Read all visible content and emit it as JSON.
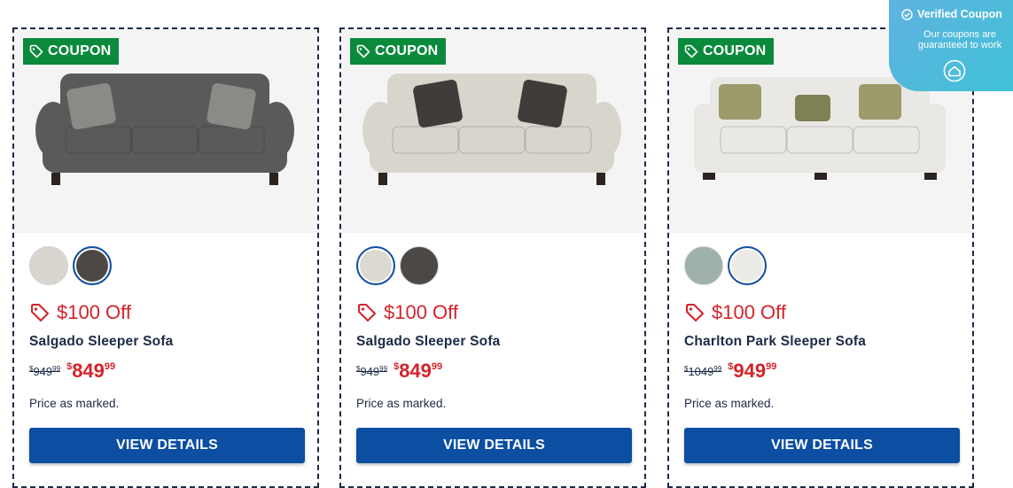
{
  "products": [
    {
      "badge": "COUPON",
      "discount": "$100 Off",
      "name": "Salgado Sleeper Sofa",
      "was_price": "949",
      "was_cents": "99",
      "now_price": "849",
      "now_cents": "99",
      "note": "Price as marked.",
      "button": "VIEW DETAILS",
      "sofa_color": "#5a5a5a",
      "swatches": [
        {
          "color": "#d9d6cf",
          "selected": false
        },
        {
          "color": "#4b4845",
          "selected": true
        }
      ]
    },
    {
      "badge": "COUPON",
      "discount": "$100 Off",
      "name": "Salgado Sleeper Sofa",
      "was_price": "949",
      "was_cents": "99",
      "now_price": "849",
      "now_cents": "99",
      "note": "Price as marked.",
      "button": "VIEW DETAILS",
      "sofa_color": "#d8d5cd",
      "swatches": [
        {
          "color": "#dcd9d1",
          "selected": true
        },
        {
          "color": "#4b4845",
          "selected": false
        }
      ]
    },
    {
      "badge": "COUPON",
      "discount": "$100 Off",
      "name": "Charlton Park Sleeper Sofa",
      "was_price": "1049",
      "was_cents": "99",
      "now_price": "949",
      "now_cents": "99",
      "note": "Price as marked.",
      "button": "VIEW DETAILS",
      "sofa_color": "#e9e8e4",
      "swatches": [
        {
          "color": "#9fb0ad",
          "selected": false
        },
        {
          "color": "#ecebe6",
          "selected": true
        }
      ]
    }
  ],
  "verified": {
    "title": "Verified Coupon",
    "subtitle": "Our coupons are guaranteed to work"
  },
  "colors": {
    "coupon_green": "#0b8a3c",
    "discount_red": "#d3232a",
    "button_blue": "#0b4ea2",
    "text_navy": "#1c2b45"
  }
}
